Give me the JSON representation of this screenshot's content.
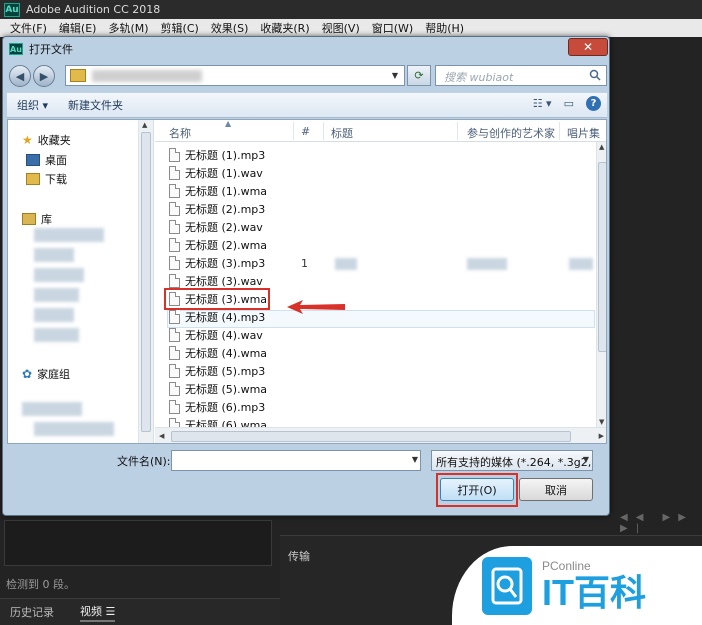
{
  "app": {
    "title": "Adobe Audition CC 2018",
    "logo_text": "Au",
    "menu": [
      "文件(F)",
      "编辑(E)",
      "多轨(M)",
      "剪辑(C)",
      "效果(S)",
      "收藏夹(R)",
      "视图(V)",
      "窗口(W)",
      "帮助(H)"
    ]
  },
  "dialog": {
    "title": "打开文件",
    "close_label": "✕",
    "search_placeholder": "搜索 wubiaot",
    "toolbar": {
      "organize": "组织 ▾",
      "new_folder": "新建文件夹"
    },
    "nav": {
      "favorites": "收藏夹",
      "desktop": "桌面",
      "downloads": "下载",
      "libraries": "库",
      "homegroup": "家庭组"
    },
    "columns": {
      "name": "名称",
      "number": "#",
      "title": "标题",
      "artist": "参与创作的艺术家",
      "album": "唱片集"
    },
    "files": [
      "无标题 (1).mp3",
      "无标题 (1).wav",
      "无标题 (1).wma",
      "无标题 (2).mp3",
      "无标题 (2).wav",
      "无标题 (2).wma",
      "无标题 (3).mp3",
      "无标题 (3).wav",
      "无标题 (3).wma",
      "无标题 (4).mp3",
      "无标题 (4).wav",
      "无标题 (4).wma",
      "无标题 (5).mp3",
      "无标题 (5).wma",
      "无标题 (6).mp3",
      "无标题 (6).wma"
    ],
    "row7_track_number": "1",
    "filename_label": "文件名(N):",
    "filename_value": "",
    "file_type": "所有支持的媒体 (*.264, *.3g2,",
    "open_button": "打开(O)",
    "cancel_button": "取消"
  },
  "background": {
    "status_text": "检测到 0 段。",
    "tab_history": "历史记录",
    "tab_video": "视频",
    "panel_transfer": "传输"
  },
  "watermark": {
    "small": "PConline",
    "big": "IT百科"
  },
  "colors": {
    "highlight_red": "#d8312a",
    "accent_blue": "#1d9fe0"
  }
}
